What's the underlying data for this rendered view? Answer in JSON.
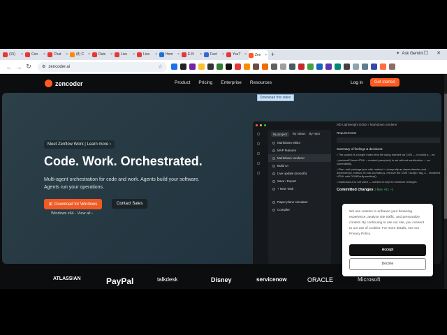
{
  "browser": {
    "tabs": [
      {
        "label": "(15)",
        "color": "#e53935"
      },
      {
        "label": "Con",
        "color": "#e53935"
      },
      {
        "label": "Chat",
        "color": "#e53935"
      },
      {
        "label": "(8) C",
        "color": "#fb8c00"
      },
      {
        "label": "Dutc",
        "color": "#e53935"
      },
      {
        "label": "Live",
        "color": "#e53935"
      },
      {
        "label": "Live",
        "color": "#e53935"
      },
      {
        "label": "Hom",
        "color": "#1e6fd9"
      },
      {
        "label": "E-N",
        "color": "#e53935"
      },
      {
        "label": "Fact",
        "color": "#3367d6"
      },
      {
        "label": "YouT",
        "color": "#e53935"
      },
      {
        "label": "Zen",
        "color": "#ff5a1f",
        "active": true
      }
    ],
    "new_tab": "+",
    "gemini_label": "Ask Gemini",
    "url": "zencoder.ai",
    "extension_colors": [
      "#1a73e8",
      "#222",
      "#7b1fa2",
      "#fbc02d",
      "#333",
      "#2e7d32",
      "#111",
      "#e53935",
      "#fb8c00",
      "#6d4c41",
      "#ef6c00",
      "#616161",
      "#9e9e9e",
      "#455a64",
      "#c62828",
      "#43a047",
      "#1565c0",
      "#5e35b1",
      "#00897b",
      "#424242",
      "#90a4ae",
      "#607d8b",
      "#3949ab",
      "#ff7043",
      "#8d6e63"
    ]
  },
  "nav": {
    "brand": "zencoder",
    "menu": [
      "Product",
      "Pricing",
      "Enterprise",
      "Resources"
    ],
    "login": "Log in",
    "get_started": "Get started"
  },
  "hero": {
    "download_badge": "Download this video",
    "announcement": "Meet Zenflow Work  |  Learn more  ›",
    "headline": "Code. Work. Orchestrated.",
    "subtext": "Multi-agent orchestration for code and work. Agents build your software. Agents run your operations.",
    "download_button": "Download for Windows",
    "sales_button": "Contact Sales",
    "platform_links": "Windows x64 · View all ›"
  },
  "app_preview": {
    "title": "MD Lightweight Editor / Markdown renderer",
    "tabs": [
      "By project",
      "By status",
      "By repo"
    ],
    "items": [
      {
        "label": "Markdown editor",
        "selected": false
      },
      {
        "label": "MVP features",
        "selected": false
      },
      {
        "label": "Markdown renderer",
        "selected": true
      },
      {
        "label": "Build UI",
        "selected": false
      },
      {
        "label": "Live update (smooth)",
        "selected": false
      },
      {
        "label": "Save / Export",
        "selected": false
      },
      {
        "label": "+ New Task",
        "selected": false
      },
      {
        "label": "Paper plane simulator",
        "selected": false
      },
      {
        "label": "Compiler",
        "selected": false
      }
    ],
    "requirements": "Requirements",
    "summary": "Summary of findings & decisions:",
    "bullets": [
      "The project is a single index.html file using marked via CDN — no build s... ed.",
      "previewEl.innerHTML = marked.parse(md) is set without sanitization — an vulnerability.",
      "Plan: add package.json with marked + dompurify as dependencies and ... dependency, extract JS into src/main.js, remove the CDN <script> tag, s... rendered HTML with DOMPurify.sanitize().",
      "markdown-it is not used — marked is kept to minimize changes."
    ],
    "committed": "Committed changes",
    "committed_stats": "3 files +81 −1"
  },
  "cookie": {
    "text": "We use cookies to enhance your browsing experience, analyze site traffic, and personalize content. By continuing to use our site, you consent to our use of cookies. For more details, see our Privacy Policy.",
    "accept": "Accept",
    "decline": "Decline"
  },
  "logos": [
    "ATLASSIAN",
    "PayPal",
    "talkdesk",
    "Disney",
    "servicenow",
    "ORACLE",
    "Microsoft"
  ]
}
